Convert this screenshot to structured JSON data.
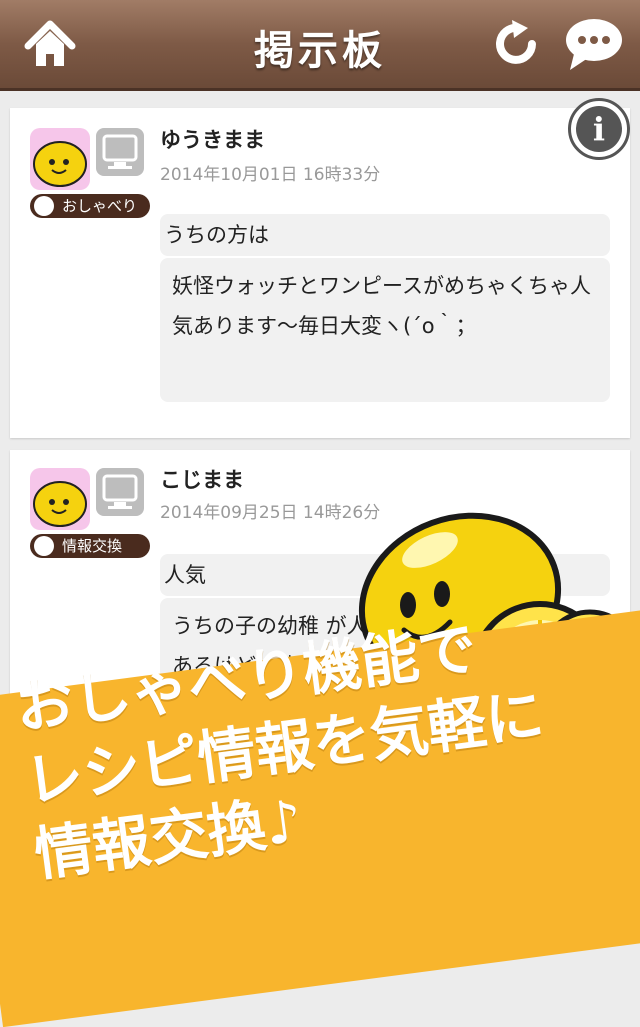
{
  "header": {
    "title": "掲示板",
    "home_icon": "home-icon",
    "refresh_icon": "refresh-icon",
    "chat_icon": "chat-bubble-icon"
  },
  "posts": [
    {
      "username": "ゆうきまま",
      "timestamp": "2014年10月01日 16時33分",
      "tag": "おしゃべり",
      "device": "PC",
      "subject": "うちの方は",
      "body": "妖怪ウォッチとワンピースがめちゃくちゃ人気あります〜毎日大変ヽ(´o｀；"
    },
    {
      "username": "こじまま",
      "timestamp": "2014年09月25日 14時26分",
      "tag": "情報交換",
      "device": "PC",
      "subject": "人気",
      "body": "うちの子の幼稚 が人気あるけど、他"
    }
  ],
  "info_label": "i",
  "promo": {
    "line1": "おしゃべり機能で",
    "line2": "レシピ情報を気軽に",
    "line3": "情報交換♪"
  },
  "colors": {
    "header_brown": "#7e5a46",
    "promo_yellow": "#f8b52d",
    "tag_brown": "#4a2b1e",
    "lemon": "#f5d20f"
  }
}
